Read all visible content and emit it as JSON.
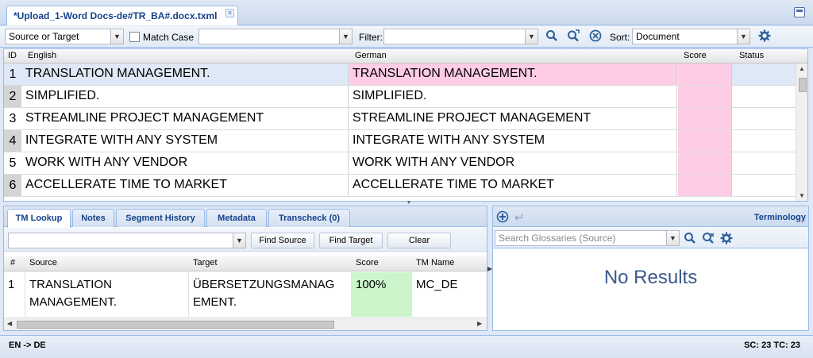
{
  "file_tab": {
    "title": "*Upload_1-Word Docs-de#TR_BA#.docx.txml",
    "close_glyph": "×"
  },
  "toolbar": {
    "scope_select": "Source or Target",
    "match_case_label": "Match Case",
    "search_value": "",
    "filter_label": "Filter:",
    "filter_value": "",
    "sort_label": "Sort:",
    "sort_value": "Document"
  },
  "grid": {
    "columns": {
      "id": "ID",
      "source": "English",
      "target": "German",
      "score": "Score",
      "status": "Status"
    },
    "rows": [
      {
        "id": "1",
        "source": "TRANSLATION MANAGEMENT.",
        "target": "TRANSLATION MANAGEMENT."
      },
      {
        "id": "2",
        "source": "SIMPLIFIED.",
        "target": "SIMPLIFIED."
      },
      {
        "id": "3",
        "source": "STREAMLINE PROJECT MANAGEMENT",
        "target": "STREAMLINE PROJECT MANAGEMENT"
      },
      {
        "id": "4",
        "source": "INTEGRATE WITH ANY SYSTEM",
        "target": "INTEGRATE WITH ANY SYSTEM"
      },
      {
        "id": "5",
        "source": "WORK WITH ANY VENDOR",
        "target": "WORK WITH ANY VENDOR"
      },
      {
        "id": "6",
        "source": "ACCELLERATE TIME TO MARKET",
        "target": "ACCELLERATE TIME TO MARKET"
      }
    ]
  },
  "bottom_tabs": [
    "TM Lookup",
    "Notes",
    "Segment History",
    "Metadata",
    "Transcheck (0)"
  ],
  "tm_lookup": {
    "search_value": "",
    "find_source_label": "Find Source",
    "find_target_label": "Find Target",
    "clear_label": "Clear",
    "columns": {
      "num": "#",
      "source": "Source",
      "target": "Target",
      "score": "Score",
      "tm_name": "TM Name"
    },
    "row": {
      "num": "1",
      "source_line1": "TRANSLATION",
      "source_line2": "MANAGEMENT.",
      "target_line1": "ÜBERSETZUNGSMANAG",
      "target_line2": "EMENT.",
      "score": "100%",
      "tm_name": "MC_DE"
    }
  },
  "terminology": {
    "title": "Terminology",
    "search_placeholder": "Search Glossaries (Source)",
    "no_results": "No Results"
  },
  "statusbar": {
    "language_pair": "EN -> DE",
    "counts": "SC: 23 TC: 23"
  },
  "colors": {
    "panel_border": "#99bbe8",
    "selected_row": "#dfe8f6",
    "target_highlight": "#ffcce6",
    "score_cell": "#ccf5cc",
    "header_text": "#15428b"
  }
}
